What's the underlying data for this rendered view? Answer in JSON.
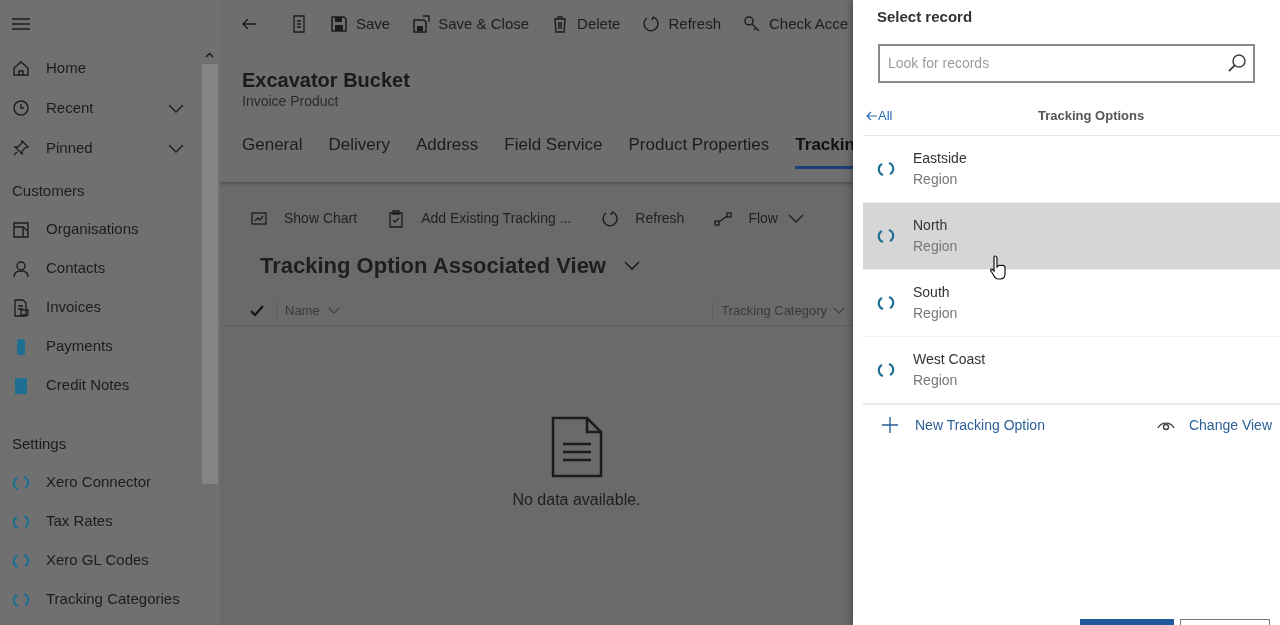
{
  "sidebar": {
    "top_items": [
      {
        "label": "Home",
        "expandable": false
      },
      {
        "label": "Recent",
        "expandable": true
      },
      {
        "label": "Pinned",
        "expandable": true
      }
    ],
    "groups": [
      {
        "title": "Customers",
        "items": [
          {
            "label": "Organisations"
          },
          {
            "label": "Contacts"
          },
          {
            "label": "Invoices"
          },
          {
            "label": "Payments"
          },
          {
            "label": "Credit Notes"
          }
        ]
      },
      {
        "title": "Settings",
        "items": [
          {
            "label": "Xero Connector"
          },
          {
            "label": "Tax Rates"
          },
          {
            "label": "Xero GL Codes"
          },
          {
            "label": "Tracking Categories"
          }
        ]
      }
    ]
  },
  "command_bar": [
    "Save",
    "Save & Close",
    "Delete",
    "Refresh",
    "Check Acce"
  ],
  "record": {
    "title": "Excavator Bucket",
    "subtitle": "Invoice Product"
  },
  "tabs": [
    {
      "label": "General",
      "selected": false
    },
    {
      "label": "Delivery",
      "selected": false
    },
    {
      "label": "Address",
      "selected": false
    },
    {
      "label": "Field Service",
      "selected": false
    },
    {
      "label": "Product Properties",
      "selected": false
    },
    {
      "label": "Trackin",
      "selected": true
    }
  ],
  "grid_toolbar": [
    {
      "label": "Show Chart",
      "dropdown": false
    },
    {
      "label": "Add Existing Tracking ...",
      "dropdown": false
    },
    {
      "label": "Refresh",
      "dropdown": false
    },
    {
      "label": "Flow",
      "dropdown": true
    }
  ],
  "view": {
    "title": "Tracking Option Associated View",
    "columns": [
      "Name",
      "Tracking Category"
    ],
    "empty_message": "No data available."
  },
  "lookup": {
    "title": "Select record",
    "search": {
      "placeholder": "Look for records"
    },
    "back_label": "All",
    "list_title": "Tracking Options",
    "records": [
      {
        "name": "Eastside",
        "type": "Region",
        "selected": false
      },
      {
        "name": "North",
        "type": "Region",
        "selected": true
      },
      {
        "name": "South",
        "type": "Region",
        "selected": false
      },
      {
        "name": "West Coast",
        "type": "Region",
        "selected": false
      }
    ],
    "new_label": "New Tracking Option",
    "change_view_label": "Change View"
  }
}
